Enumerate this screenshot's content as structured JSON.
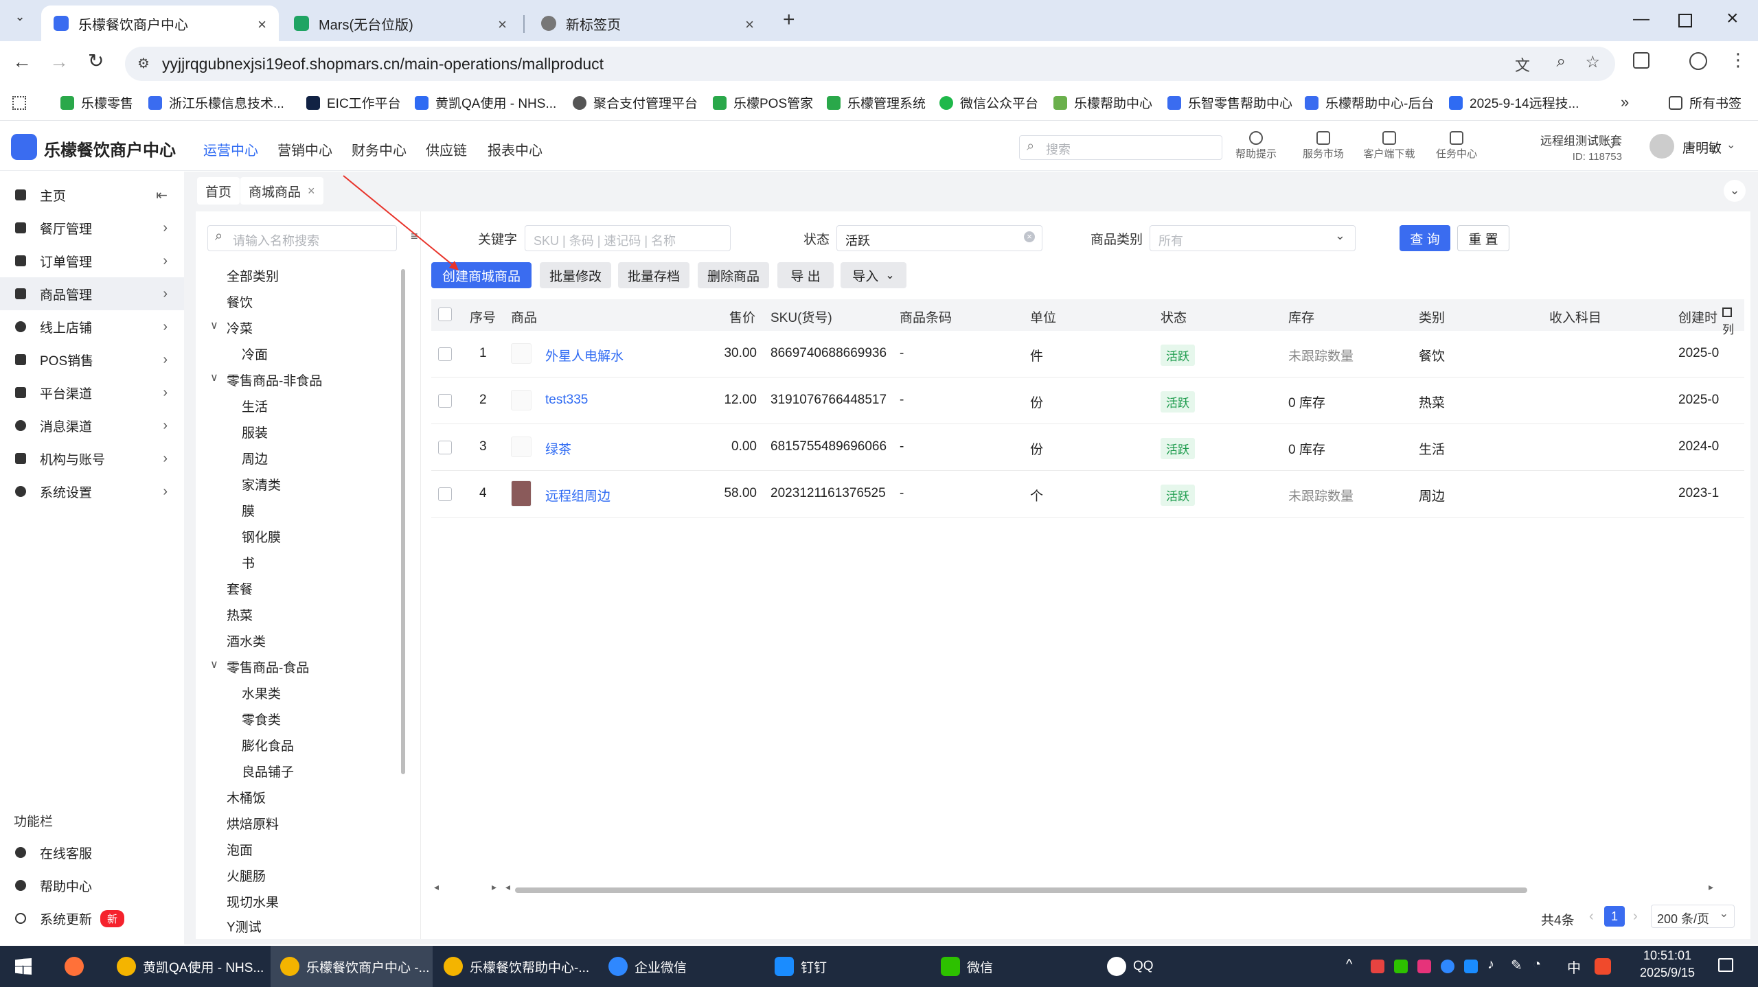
{
  "browser": {
    "tabs": [
      {
        "label": "乐檬餐饮商户中心",
        "active": true
      },
      {
        "label": "Mars(无台位版)",
        "active": false
      },
      {
        "label": "新标签页",
        "active": false
      }
    ],
    "new_tab_glyph": "+",
    "url": "yyjjrqgubnexjsi19eof.shopmars.cn/main-operations/mallproduct",
    "bookmarks": [
      "乐檬零售",
      "浙江乐檬信息技术...",
      "EIC工作平台",
      "黄凯QA使用 - NHS...",
      "聚合支付管理平台",
      "乐檬POS管家",
      "乐檬管理系统",
      "微信公众平台",
      "乐檬帮助中心",
      "乐智零售帮助中心",
      "乐檬帮助中心-后台",
      "2025-9-14远程技..."
    ],
    "all_bookmarks": "所有书签"
  },
  "app": {
    "brand": "乐檬餐饮商户中心",
    "nav": [
      "运营中心",
      "营销中心",
      "财务中心",
      "供应链",
      "报表中心"
    ],
    "nav_active": "运营中心",
    "search_placeholder": "搜索",
    "header_icons": [
      "帮助提示",
      "服务市场",
      "客户端下载",
      "任务中心"
    ],
    "account": {
      "name": "远程组测试账套",
      "id": "ID: 118753"
    },
    "user": "唐明敏"
  },
  "sidebar": {
    "items": [
      {
        "label": "主页",
        "icon": "home-icon"
      },
      {
        "label": "餐厅管理",
        "icon": "store-icon"
      },
      {
        "label": "订单管理",
        "icon": "order-icon"
      },
      {
        "label": "商品管理",
        "icon": "product-icon",
        "selected": true
      },
      {
        "label": "线上店铺",
        "icon": "globe-icon"
      },
      {
        "label": "POS销售",
        "icon": "pos-icon"
      },
      {
        "label": "平台渠道",
        "icon": "bank-icon"
      },
      {
        "label": "消息渠道",
        "icon": "chat-icon"
      },
      {
        "label": "机构与账号",
        "icon": "id-card-icon"
      },
      {
        "label": "系统设置",
        "icon": "gear-icon"
      }
    ],
    "function_bar_title": "功能栏",
    "bottom": [
      {
        "label": "在线客服",
        "icon": "headset-icon"
      },
      {
        "label": "帮助中心",
        "icon": "help-icon"
      },
      {
        "label": "系统更新",
        "icon": "refresh-icon",
        "badge": "新"
      }
    ]
  },
  "page_tabs": [
    "首页",
    "商城商品"
  ],
  "tree": {
    "search_placeholder": "请输入名称搜索",
    "nodes": [
      {
        "label": "全部类别",
        "level": 0
      },
      {
        "label": "餐饮",
        "level": 0
      },
      {
        "label": "冷菜",
        "level": 0,
        "expanded": true
      },
      {
        "label": "冷面",
        "level": 1
      },
      {
        "label": "零售商品-非食品",
        "level": 0,
        "expanded": true
      },
      {
        "label": "生活",
        "level": 1
      },
      {
        "label": "服装",
        "level": 1
      },
      {
        "label": "周边",
        "level": 1
      },
      {
        "label": "家清类",
        "level": 1
      },
      {
        "label": "膜",
        "level": 1
      },
      {
        "label": "钢化膜",
        "level": 1
      },
      {
        "label": "书",
        "level": 1
      },
      {
        "label": "套餐",
        "level": 0
      },
      {
        "label": "热菜",
        "level": 0
      },
      {
        "label": "酒水类",
        "level": 0
      },
      {
        "label": "零售商品-食品",
        "level": 0,
        "expanded": true
      },
      {
        "label": "水果类",
        "level": 1
      },
      {
        "label": "零食类",
        "level": 1
      },
      {
        "label": "膨化食品",
        "level": 1
      },
      {
        "label": "良品铺子",
        "level": 1
      },
      {
        "label": "木桶饭",
        "level": 0
      },
      {
        "label": "烘焙原料",
        "level": 0
      },
      {
        "label": "泡面",
        "level": 0
      },
      {
        "label": "火腿肠",
        "level": 0
      },
      {
        "label": "现切水果",
        "level": 0
      },
      {
        "label": "Y测试",
        "level": 0
      }
    ]
  },
  "filters": {
    "keyword_label": "关键字",
    "keyword_placeholder": "SKU | 条码 | 速记码 | 名称",
    "status_label": "状态",
    "status_value": "活跃",
    "category_label": "商品类别",
    "category_placeholder": "所有",
    "query_btn": "查 询",
    "reset_btn": "重 置"
  },
  "actions": [
    "创建商城商品",
    "批量修改",
    "批量存档",
    "删除商品",
    "导 出",
    "导入"
  ],
  "table": {
    "columns": [
      "序号",
      "商品",
      "售价",
      "SKU(货号)",
      "商品条码",
      "单位",
      "状态",
      "库存",
      "类别",
      "收入科目",
      "创建时"
    ],
    "column_settings_label": "列",
    "rows": [
      {
        "no": "1",
        "name": "外星人电解水",
        "price": "30.00",
        "sku": "8669740688669936",
        "barcode": "-",
        "unit": "件",
        "status": "活跃",
        "stock": "未跟踪数量",
        "category": "餐饮",
        "income": "",
        "created": "2025-0"
      },
      {
        "no": "2",
        "name": "test335",
        "price": "12.00",
        "sku": "3191076766448517",
        "barcode": "-",
        "unit": "份",
        "status": "活跃",
        "stock": "0 库存",
        "category": "热菜",
        "income": "",
        "created": "2025-0"
      },
      {
        "no": "3",
        "name": "绿茶",
        "price": "0.00",
        "sku": "6815755489696066",
        "barcode": "-",
        "unit": "份",
        "status": "活跃",
        "stock": "0 库存",
        "category": "生活",
        "income": "",
        "created": "2024-0"
      },
      {
        "no": "4",
        "name": "远程组周边",
        "price": "58.00",
        "sku": "2023121161376525",
        "barcode": "-",
        "unit": "个",
        "status": "活跃",
        "stock": "未跟踪数量",
        "category": "周边",
        "income": "",
        "created": "2023-1"
      }
    ]
  },
  "pagination": {
    "total": "共4条",
    "current": "1",
    "page_size": "200 条/页"
  },
  "taskbar": {
    "items": [
      "黄凯QA使用 - NHS...",
      "乐檬餐饮商户中心 -...",
      "乐檬餐饮帮助中心-...",
      "企业微信",
      "钉钉",
      "微信",
      "QQ"
    ],
    "time": "10:51:01",
    "date": "2025/9/15",
    "ime": "中"
  }
}
